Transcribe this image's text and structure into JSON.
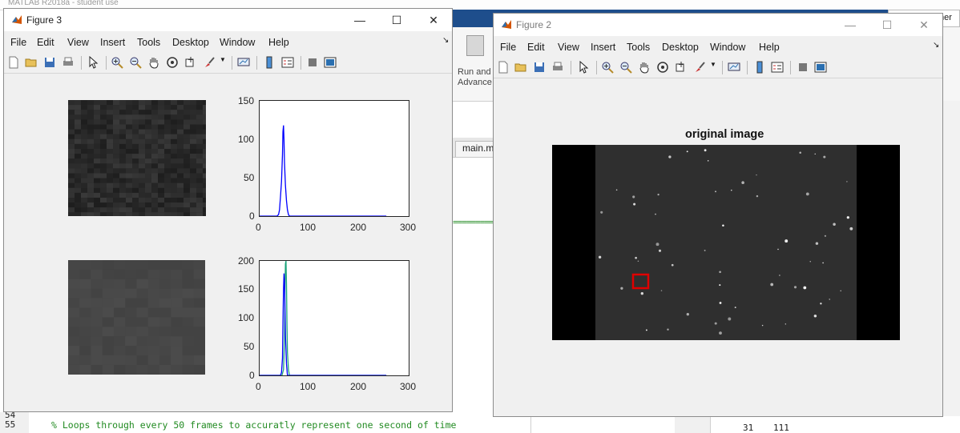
{
  "background": {
    "app_title": "MATLAB R2018a - student use",
    "run_button_label": "Run and",
    "run_button_label2": "Advance",
    "ribbon_right_text": "mer",
    "editor_tab": "main.m",
    "line_numbers": [
      "54",
      "55"
    ],
    "code_line": "% Loops through every 50 frames to accuratly represent one second of time",
    "workspace_row": [
      "31",
      "111"
    ]
  },
  "figure3": {
    "title": "Figure 3",
    "menus": [
      "File",
      "Edit",
      "View",
      "Insert",
      "Tools",
      "Desktop",
      "Window",
      "Help"
    ],
    "colors": {
      "line_blue": "#0000ff",
      "line_green": "#1aa37a",
      "patch_dark": "#2c2c2c",
      "patch_mid": "#4b4b4b"
    },
    "histograms": [
      {
        "ylabels": [
          "150",
          "100",
          "50",
          "0"
        ],
        "xlabels": [
          "0",
          "100",
          "200",
          "300"
        ]
      },
      {
        "ylabels": [
          "200",
          "150",
          "100",
          "50",
          "0"
        ],
        "xlabels": [
          "0",
          "100",
          "200",
          "300"
        ]
      }
    ]
  },
  "figure2": {
    "title": "Figure 2",
    "menus": [
      "File",
      "Edit",
      "View",
      "Insert",
      "Tools",
      "Desktop",
      "Window",
      "Help"
    ],
    "axes_title": "original image",
    "colors": {
      "roi_box": "#e00000",
      "image_bg": "#2f2f2f",
      "border": "#000000"
    }
  },
  "chart_data": [
    {
      "type": "line",
      "title": "",
      "xlabel": "",
      "ylabel": "",
      "xlim": [
        0,
        300
      ],
      "ylim": [
        0,
        150
      ],
      "series": [
        {
          "color": "#0000ff",
          "x": [
            0,
            35,
            38,
            40,
            42,
            44,
            46,
            47,
            48,
            49,
            50,
            52,
            54,
            56,
            58,
            60,
            255
          ],
          "y": [
            0,
            0,
            2,
            8,
            25,
            45,
            80,
            110,
            118,
            100,
            70,
            40,
            20,
            8,
            2,
            0,
            0
          ]
        }
      ]
    },
    {
      "type": "line",
      "title": "",
      "xlabel": "",
      "ylabel": "",
      "xlim": [
        0,
        300
      ],
      "ylim": [
        0,
        200
      ],
      "series": [
        {
          "color": "#1aa37a",
          "x": [
            0,
            45,
            48,
            50,
            51,
            52,
            53,
            54,
            55,
            56,
            58,
            60,
            255
          ],
          "y": [
            0,
            0,
            10,
            60,
            150,
            195,
            200,
            160,
            90,
            40,
            10,
            0,
            0
          ]
        },
        {
          "color": "#0000ff",
          "x": [
            0,
            42,
            44,
            46,
            47,
            48,
            49,
            50,
            51,
            52,
            54,
            56,
            255
          ],
          "y": [
            0,
            0,
            5,
            30,
            90,
            150,
            178,
            165,
            120,
            70,
            20,
            0,
            0
          ]
        }
      ]
    }
  ]
}
